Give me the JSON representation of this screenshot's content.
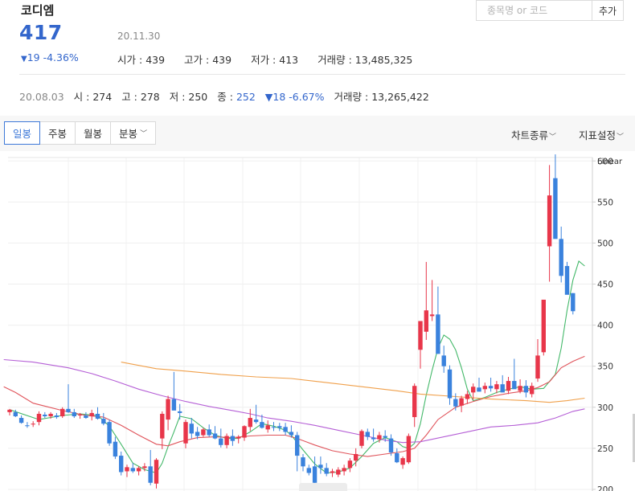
{
  "stock": {
    "name": "코디엠",
    "price": "417",
    "date": "20.11.30",
    "change_arrow": "▼",
    "change_value": "19",
    "change_pct": "-4.36%",
    "open_label": "시가",
    "open": "439",
    "high_label": "고가",
    "high": "439",
    "low_label": "저가",
    "low": "413",
    "volume_label": "거래량",
    "volume": "13,485,325"
  },
  "search": {
    "placeholder": "종목명 or 코드",
    "add_label": "추가"
  },
  "prev_day": {
    "date": "20.08.03",
    "open_label": "시",
    "open": "274",
    "high_label": "고",
    "high": "278",
    "low_label": "저",
    "low": "250",
    "close_label": "종",
    "close": "252",
    "change_arrow": "▼",
    "change_value": "18",
    "change_pct": "-6.67%",
    "volume_label": "거래량",
    "volume": "13,265,422"
  },
  "toolbar": {
    "tabs": [
      {
        "label": "일봉",
        "active": true
      },
      {
        "label": "주봉",
        "active": false
      },
      {
        "label": "월봉",
        "active": false
      },
      {
        "label": "분봉",
        "active": false,
        "dropdown": true
      }
    ],
    "chart_type_label": "차트종류",
    "indicator_label": "지표설정",
    "chevron_icon": "chevron-down-icon"
  },
  "colors": {
    "up": "#e8364a",
    "down": "#3a82dd",
    "ma5": "#43b869",
    "ma20": "#e0535a",
    "ma60": "#b55fd6",
    "ma120": "#f0a04b",
    "accent": "#3366cc"
  },
  "chart_data": {
    "type": "candlestick",
    "scale_label": "Linear",
    "ylim": [
      198,
      612
    ],
    "y_ticks": [
      200,
      250,
      300,
      350,
      400,
      450,
      500,
      550,
      600
    ],
    "grid": true,
    "candles": [
      {
        "o": 294,
        "h": 298,
        "l": 290,
        "c": 297
      },
      {
        "o": 294,
        "h": 297,
        "l": 288,
        "c": 289
      },
      {
        "o": 287,
        "h": 290,
        "l": 280,
        "c": 281
      },
      {
        "o": 278,
        "h": 282,
        "l": 275,
        "c": 277
      },
      {
        "o": 279,
        "h": 283,
        "l": 276,
        "c": 280
      },
      {
        "o": 282,
        "h": 295,
        "l": 278,
        "c": 292
      },
      {
        "o": 291,
        "h": 294,
        "l": 287,
        "c": 289
      },
      {
        "o": 289,
        "h": 294,
        "l": 286,
        "c": 292
      },
      {
        "o": 290,
        "h": 293,
        "l": 286,
        "c": 288
      },
      {
        "o": 289,
        "h": 300,
        "l": 287,
        "c": 298
      },
      {
        "o": 298,
        "h": 328,
        "l": 293,
        "c": 294
      },
      {
        "o": 294,
        "h": 298,
        "l": 287,
        "c": 289
      },
      {
        "o": 290,
        "h": 293,
        "l": 286,
        "c": 291
      },
      {
        "o": 290,
        "h": 294,
        "l": 286,
        "c": 287
      },
      {
        "o": 289,
        "h": 297,
        "l": 284,
        "c": 293
      },
      {
        "o": 292,
        "h": 300,
        "l": 285,
        "c": 286
      },
      {
        "o": 286,
        "h": 293,
        "l": 278,
        "c": 280
      },
      {
        "o": 282,
        "h": 285,
        "l": 253,
        "c": 256
      },
      {
        "o": 258,
        "h": 264,
        "l": 237,
        "c": 240
      },
      {
        "o": 241,
        "h": 246,
        "l": 217,
        "c": 221
      },
      {
        "o": 222,
        "h": 230,
        "l": 215,
        "c": 227
      },
      {
        "o": 226,
        "h": 232,
        "l": 220,
        "c": 222
      },
      {
        "o": 222,
        "h": 228,
        "l": 217,
        "c": 226
      },
      {
        "o": 226,
        "h": 232,
        "l": 222,
        "c": 228
      },
      {
        "o": 228,
        "h": 248,
        "l": 205,
        "c": 208
      },
      {
        "o": 207,
        "h": 238,
        "l": 201,
        "c": 236
      },
      {
        "o": 262,
        "h": 295,
        "l": 249,
        "c": 292
      },
      {
        "o": 285,
        "h": 314,
        "l": 272,
        "c": 310
      },
      {
        "o": 310,
        "h": 343,
        "l": 297,
        "c": 296
      },
      {
        "o": 295,
        "h": 304,
        "l": 285,
        "c": 293
      },
      {
        "o": 256,
        "h": 285,
        "l": 250,
        "c": 282
      },
      {
        "o": 280,
        "h": 287,
        "l": 262,
        "c": 268
      },
      {
        "o": 270,
        "h": 276,
        "l": 261,
        "c": 265
      },
      {
        "o": 266,
        "h": 275,
        "l": 264,
        "c": 273
      },
      {
        "o": 273,
        "h": 279,
        "l": 264,
        "c": 266
      },
      {
        "o": 268,
        "h": 277,
        "l": 261,
        "c": 262
      },
      {
        "o": 262,
        "h": 274,
        "l": 251,
        "c": 254
      },
      {
        "o": 254,
        "h": 268,
        "l": 250,
        "c": 265
      },
      {
        "o": 265,
        "h": 273,
        "l": 253,
        "c": 259
      },
      {
        "o": 262,
        "h": 266,
        "l": 256,
        "c": 264
      },
      {
        "o": 263,
        "h": 278,
        "l": 259,
        "c": 277
      },
      {
        "o": 276,
        "h": 298,
        "l": 271,
        "c": 287
      },
      {
        "o": 285,
        "h": 303,
        "l": 280,
        "c": 282
      },
      {
        "o": 282,
        "h": 291,
        "l": 274,
        "c": 275
      },
      {
        "o": 273,
        "h": 284,
        "l": 269,
        "c": 278
      },
      {
        "o": 276,
        "h": 282,
        "l": 271,
        "c": 275
      },
      {
        "o": 277,
        "h": 281,
        "l": 271,
        "c": 275
      },
      {
        "o": 276,
        "h": 281,
        "l": 266,
        "c": 270
      },
      {
        "o": 270,
        "h": 278,
        "l": 263,
        "c": 266
      },
      {
        "o": 266,
        "h": 270,
        "l": 222,
        "c": 241
      },
      {
        "o": 239,
        "h": 243,
        "l": 222,
        "c": 228
      },
      {
        "o": 226,
        "h": 230,
        "l": 217,
        "c": 220
      },
      {
        "o": 228,
        "h": 240,
        "l": 205,
        "c": 208
      },
      {
        "o": 230,
        "h": 240,
        "l": 219,
        "c": 226
      },
      {
        "o": 226,
        "h": 232,
        "l": 216,
        "c": 219
      },
      {
        "o": 220,
        "h": 225,
        "l": 215,
        "c": 222
      },
      {
        "o": 218,
        "h": 227,
        "l": 215,
        "c": 224
      },
      {
        "o": 222,
        "h": 230,
        "l": 217,
        "c": 226
      },
      {
        "o": 226,
        "h": 238,
        "l": 221,
        "c": 235
      },
      {
        "o": 235,
        "h": 250,
        "l": 228,
        "c": 243
      },
      {
        "o": 253,
        "h": 273,
        "l": 250,
        "c": 271
      },
      {
        "o": 270,
        "h": 274,
        "l": 260,
        "c": 264
      },
      {
        "o": 263,
        "h": 274,
        "l": 258,
        "c": 261
      },
      {
        "o": 261,
        "h": 270,
        "l": 257,
        "c": 266
      },
      {
        "o": 265,
        "h": 272,
        "l": 258,
        "c": 263
      },
      {
        "o": 262,
        "h": 267,
        "l": 241,
        "c": 245
      },
      {
        "o": 244,
        "h": 250,
        "l": 232,
        "c": 233
      },
      {
        "o": 230,
        "h": 240,
        "l": 225,
        "c": 238
      },
      {
        "o": 233,
        "h": 268,
        "l": 231,
        "c": 265
      },
      {
        "o": 288,
        "h": 329,
        "l": 276,
        "c": 326
      },
      {
        "o": 370,
        "h": 392,
        "l": 347,
        "c": 405
      },
      {
        "o": 392,
        "h": 477,
        "l": 382,
        "c": 418
      },
      {
        "o": 411,
        "h": 455,
        "l": 405,
        "c": 413
      },
      {
        "o": 413,
        "h": 447,
        "l": 384,
        "c": 365
      },
      {
        "o": 363,
        "h": 375,
        "l": 342,
        "c": 350
      },
      {
        "o": 346,
        "h": 351,
        "l": 303,
        "c": 311
      },
      {
        "o": 310,
        "h": 317,
        "l": 296,
        "c": 301
      },
      {
        "o": 302,
        "h": 314,
        "l": 294,
        "c": 311
      },
      {
        "o": 310,
        "h": 320,
        "l": 304,
        "c": 316
      },
      {
        "o": 318,
        "h": 329,
        "l": 309,
        "c": 325
      },
      {
        "o": 324,
        "h": 336,
        "l": 319,
        "c": 319
      },
      {
        "o": 322,
        "h": 330,
        "l": 317,
        "c": 326
      },
      {
        "o": 326,
        "h": 336,
        "l": 319,
        "c": 323
      },
      {
        "o": 322,
        "h": 332,
        "l": 317,
        "c": 328
      },
      {
        "o": 328,
        "h": 339,
        "l": 320,
        "c": 318
      },
      {
        "o": 320,
        "h": 337,
        "l": 316,
        "c": 332
      },
      {
        "o": 332,
        "h": 359,
        "l": 328,
        "c": 322
      },
      {
        "o": 320,
        "h": 334,
        "l": 317,
        "c": 326
      },
      {
        "o": 326,
        "h": 333,
        "l": 312,
        "c": 318
      },
      {
        "o": 316,
        "h": 330,
        "l": 312,
        "c": 326
      },
      {
        "o": 335,
        "h": 383,
        "l": 331,
        "c": 363
      },
      {
        "o": 367,
        "h": 430,
        "l": 363,
        "c": 431
      },
      {
        "o": 496,
        "h": 595,
        "l": 453,
        "c": 558
      },
      {
        "o": 579,
        "h": 608,
        "l": 517,
        "c": 505
      },
      {
        "o": 505,
        "h": 520,
        "l": 452,
        "c": 460
      },
      {
        "o": 472,
        "h": 477,
        "l": 443,
        "c": 437
      },
      {
        "o": 439,
        "h": 439,
        "l": 413,
        "c": 417
      }
    ],
    "moving_averages": [
      {
        "name": "MA5",
        "points": [
          [
            0,
            297
          ],
          [
            5,
            285
          ],
          [
            9,
            290
          ],
          [
            12,
            292
          ],
          [
            15,
            290
          ],
          [
            17,
            277
          ],
          [
            19,
            255
          ],
          [
            21,
            232
          ],
          [
            23,
            224
          ],
          [
            25,
            220
          ],
          [
            26,
            232
          ],
          [
            27,
            252
          ],
          [
            28,
            270
          ],
          [
            29,
            289
          ],
          [
            31,
            286
          ],
          [
            33,
            275
          ],
          [
            35,
            266
          ],
          [
            37,
            262
          ],
          [
            39,
            262
          ],
          [
            41,
            270
          ],
          [
            43,
            280
          ],
          [
            45,
            277
          ],
          [
            47,
            272
          ],
          [
            48,
            266
          ],
          [
            50,
            248
          ],
          [
            52,
            231
          ],
          [
            54,
            220
          ],
          [
            56,
            221
          ],
          [
            58,
            226
          ],
          [
            60,
            240
          ],
          [
            62,
            256
          ],
          [
            64,
            263
          ],
          [
            66,
            258
          ],
          [
            67,
            252
          ],
          [
            68,
            250
          ],
          [
            69,
            256
          ],
          [
            70,
            280
          ],
          [
            71,
            315
          ],
          [
            72,
            345
          ],
          [
            73,
            372
          ],
          [
            74,
            388
          ],
          [
            75,
            383
          ],
          [
            76,
            370
          ],
          [
            77,
            348
          ],
          [
            78,
            322
          ],
          [
            79,
            308
          ],
          [
            81,
            312
          ],
          [
            83,
            318
          ],
          [
            85,
            322
          ],
          [
            87,
            325
          ],
          [
            89,
            322
          ],
          [
            91,
            323
          ],
          [
            93,
            340
          ],
          [
            94,
            372
          ],
          [
            95,
            418
          ],
          [
            96,
            455
          ],
          [
            97,
            478
          ],
          [
            98,
            472
          ]
        ]
      },
      {
        "name": "MA20",
        "points": [
          [
            -1,
            325
          ],
          [
            1,
            318
          ],
          [
            4,
            305
          ],
          [
            9,
            296
          ],
          [
            13,
            290
          ],
          [
            16,
            288
          ],
          [
            19,
            278
          ],
          [
            22,
            266
          ],
          [
            25,
            255
          ],
          [
            27,
            253
          ],
          [
            29,
            258
          ],
          [
            32,
            263
          ],
          [
            35,
            264
          ],
          [
            38,
            263
          ],
          [
            41,
            265
          ],
          [
            44,
            266
          ],
          [
            47,
            266
          ],
          [
            49,
            262
          ],
          [
            52,
            254
          ],
          [
            55,
            247
          ],
          [
            58,
            243
          ],
          [
            61,
            240
          ],
          [
            64,
            243
          ],
          [
            67,
            246
          ],
          [
            69,
            250
          ],
          [
            71,
            266
          ],
          [
            73,
            285
          ],
          [
            76,
            300
          ],
          [
            79,
            307
          ],
          [
            82,
            313
          ],
          [
            85,
            317
          ],
          [
            88,
            320
          ],
          [
            90,
            324
          ],
          [
            92,
            331
          ],
          [
            94,
            348
          ],
          [
            96,
            356
          ],
          [
            98,
            362
          ]
        ]
      },
      {
        "name": "MA60",
        "points": [
          [
            -1,
            358
          ],
          [
            4,
            355
          ],
          [
            10,
            348
          ],
          [
            14,
            341
          ],
          [
            18,
            332
          ],
          [
            22,
            322
          ],
          [
            26,
            314
          ],
          [
            30,
            307
          ],
          [
            34,
            301
          ],
          [
            38,
            296
          ],
          [
            41,
            292
          ],
          [
            44,
            287
          ],
          [
            48,
            283
          ],
          [
            52,
            278
          ],
          [
            56,
            272
          ],
          [
            60,
            266
          ],
          [
            64,
            260
          ],
          [
            67,
            257
          ],
          [
            70,
            258
          ],
          [
            74,
            264
          ],
          [
            78,
            270
          ],
          [
            82,
            276
          ],
          [
            86,
            278
          ],
          [
            90,
            281
          ],
          [
            93,
            287
          ],
          [
            96,
            295
          ],
          [
            98,
            298
          ]
        ]
      },
      {
        "name": "MA120",
        "points": [
          [
            19,
            355
          ],
          [
            25,
            347
          ],
          [
            30,
            344
          ],
          [
            36,
            340
          ],
          [
            42,
            337
          ],
          [
            48,
            335
          ],
          [
            54,
            330
          ],
          [
            60,
            325
          ],
          [
            66,
            320
          ],
          [
            70,
            316
          ],
          [
            76,
            313
          ],
          [
            82,
            310
          ],
          [
            88,
            308
          ],
          [
            92,
            306
          ],
          [
            95,
            308
          ],
          [
            98,
            311
          ]
        ]
      }
    ]
  }
}
